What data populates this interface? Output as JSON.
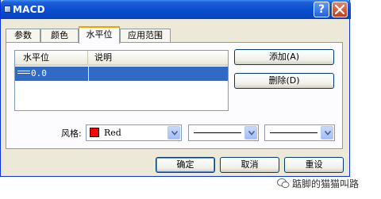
{
  "window": {
    "title": "MACD"
  },
  "titlebar_buttons": {
    "help": "?",
    "close": "close"
  },
  "tabs": [
    {
      "label": "参数"
    },
    {
      "label": "颜色"
    },
    {
      "label": "水平位"
    },
    {
      "label": "应用范围"
    }
  ],
  "levels_table": {
    "columns": [
      "水平位",
      "说明"
    ],
    "rows": [
      {
        "value": "0.0",
        "description": ""
      }
    ]
  },
  "side_buttons": {
    "add": "添加(A)",
    "delete": "删除(D)"
  },
  "style": {
    "label": "风格:",
    "color_name": "Red",
    "color_hex": "#ff0000",
    "line_style": "solid",
    "line_width": "thin"
  },
  "footer_buttons": {
    "ok": "确定",
    "cancel": "取消",
    "reset": "重设"
  },
  "watermark": {
    "text": "踮脚的猫猫叫路"
  }
}
